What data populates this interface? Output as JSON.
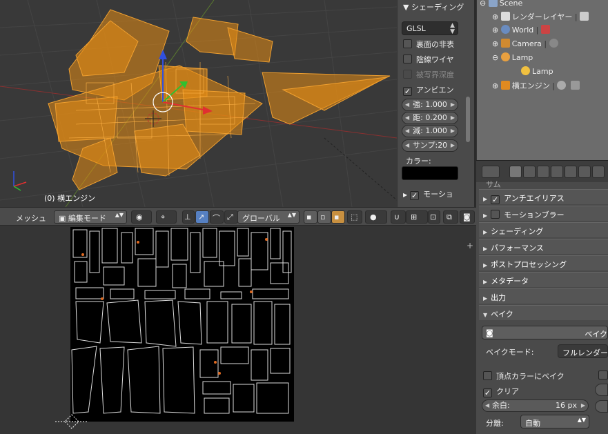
{
  "viewport3d": {
    "object_label": "(0) 横エンジン"
  },
  "npanel": {
    "title": "シェーディング",
    "shading_mode": "GLSL",
    "checks": [
      {
        "label": "裏面の非表",
        "checked": false,
        "disabled": false
      },
      {
        "label": "陰線ワイヤ",
        "checked": false,
        "disabled": false
      },
      {
        "label": "被写界深度",
        "checked": false,
        "disabled": true
      },
      {
        "label": "アンビエン",
        "checked": true,
        "disabled": false
      }
    ],
    "fields": [
      "強: 1.000",
      "距: 0.200",
      "減: 1.000",
      "サンプ:20"
    ],
    "color_label": "カラー:",
    "motion_label": "モーショ"
  },
  "header3d": {
    "menu_mesh": "メッシュ",
    "mode": "編集モード",
    "orientation": "グローバル"
  },
  "outliner": {
    "rows": [
      {
        "label": "Scene",
        "indent": 0
      },
      {
        "label": "レンダーレイヤー",
        "indent": 1
      },
      {
        "label": "World",
        "indent": 1
      },
      {
        "label": "Camera",
        "indent": 1
      },
      {
        "label": "Lamp",
        "indent": 1
      },
      {
        "label": "Lamp",
        "indent": 2
      },
      {
        "label": "横エンジン",
        "indent": 1
      }
    ]
  },
  "properties": {
    "top_partial": "サム",
    "sections": [
      {
        "label": "アンチエイリアス",
        "checkbox": true,
        "checked": true
      },
      {
        "label": "モーションブラー",
        "checkbox": true,
        "checked": false
      },
      {
        "label": "シェーディング",
        "checkbox": false
      },
      {
        "label": "パフォーマンス",
        "checkbox": false
      },
      {
        "label": "ポストプロセッシング",
        "checkbox": false
      },
      {
        "label": "メタデータ",
        "checkbox": false
      },
      {
        "label": "出力",
        "checkbox": false
      },
      {
        "label": "ベイク",
        "checkbox": false,
        "open": true
      }
    ],
    "bake_button": "ベイク",
    "bake_mode_label": "ベイクモード:",
    "bake_mode_value": "フルレンダー",
    "vertex_color_label": "頂点カラーにベイク",
    "clear_label": "クリア",
    "clear_checked": true,
    "margin_label": "余白:",
    "margin_value": "16 px",
    "split_label": "分離:",
    "split_value": "自動"
  }
}
